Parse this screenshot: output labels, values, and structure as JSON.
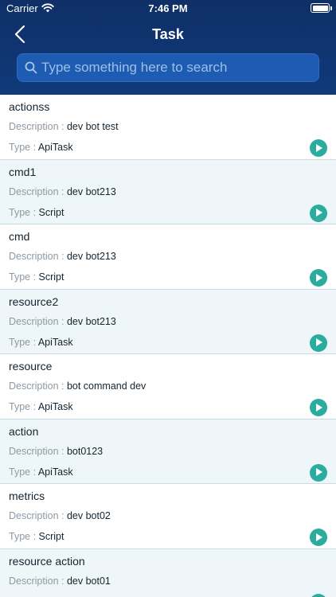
{
  "status_bar": {
    "carrier": "Carrier",
    "time": "7:46 PM"
  },
  "nav": {
    "title": "Task"
  },
  "search": {
    "placeholder": "Type something here to search"
  },
  "labels": {
    "description": "Description : ",
    "type": "Type : "
  },
  "tasks": [
    {
      "name": "actionss",
      "description": "dev bot test",
      "type": "ApiTask"
    },
    {
      "name": "cmd1",
      "description": "dev bot213",
      "type": "Script"
    },
    {
      "name": "cmd",
      "description": "dev bot213",
      "type": "Script"
    },
    {
      "name": "resource2",
      "description": "dev bot213",
      "type": "ApiTask"
    },
    {
      "name": "resource",
      "description": "bot command dev",
      "type": "ApiTask"
    },
    {
      "name": "action",
      "description": "bot0123",
      "type": "ApiTask"
    },
    {
      "name": "metrics",
      "description": "dev bot02",
      "type": "Script"
    },
    {
      "name": "resource action",
      "description": "dev bot01",
      "type": ""
    }
  ],
  "colors": {
    "header": "#0f2f66",
    "search_bg": "#1e5cb3",
    "row_alt": "#eef6f9",
    "play": "#2aac9e"
  }
}
